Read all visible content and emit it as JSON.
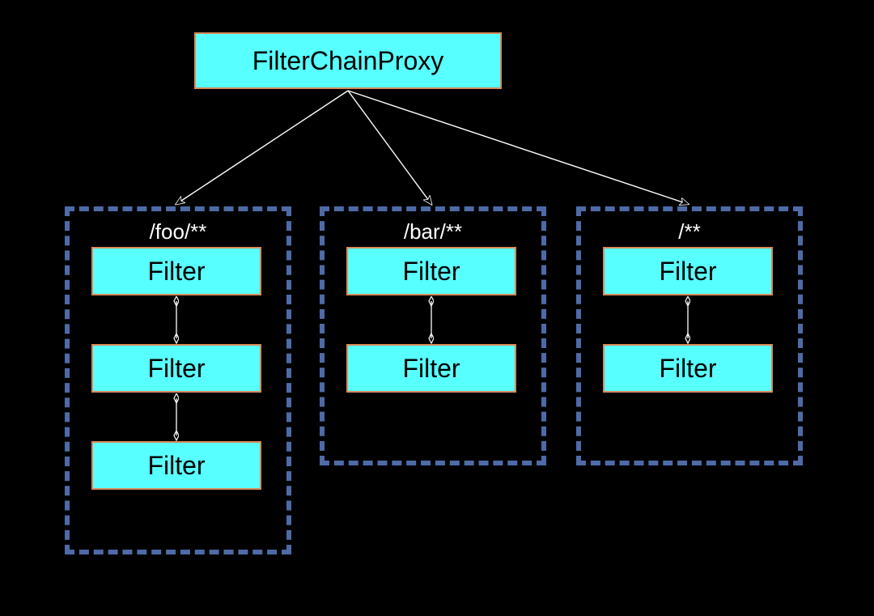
{
  "colors": {
    "background": "#000000",
    "box_fill": "#58FFFF",
    "box_border": "#D88A5A",
    "cluster_border": "#4E6BA8",
    "cluster_title": "#FFFFFF",
    "arrow": "#000000",
    "arrow_stroke": "#FFFFFF"
  },
  "root": {
    "label": "FilterChainProxy"
  },
  "clusters": [
    {
      "title": "/foo/**",
      "filters": [
        "Filter",
        "Filter",
        "Filter"
      ]
    },
    {
      "title": "/bar/**",
      "filters": [
        "Filter",
        "Filter"
      ]
    },
    {
      "title": "/**",
      "filters": [
        "Filter",
        "Filter"
      ]
    }
  ]
}
